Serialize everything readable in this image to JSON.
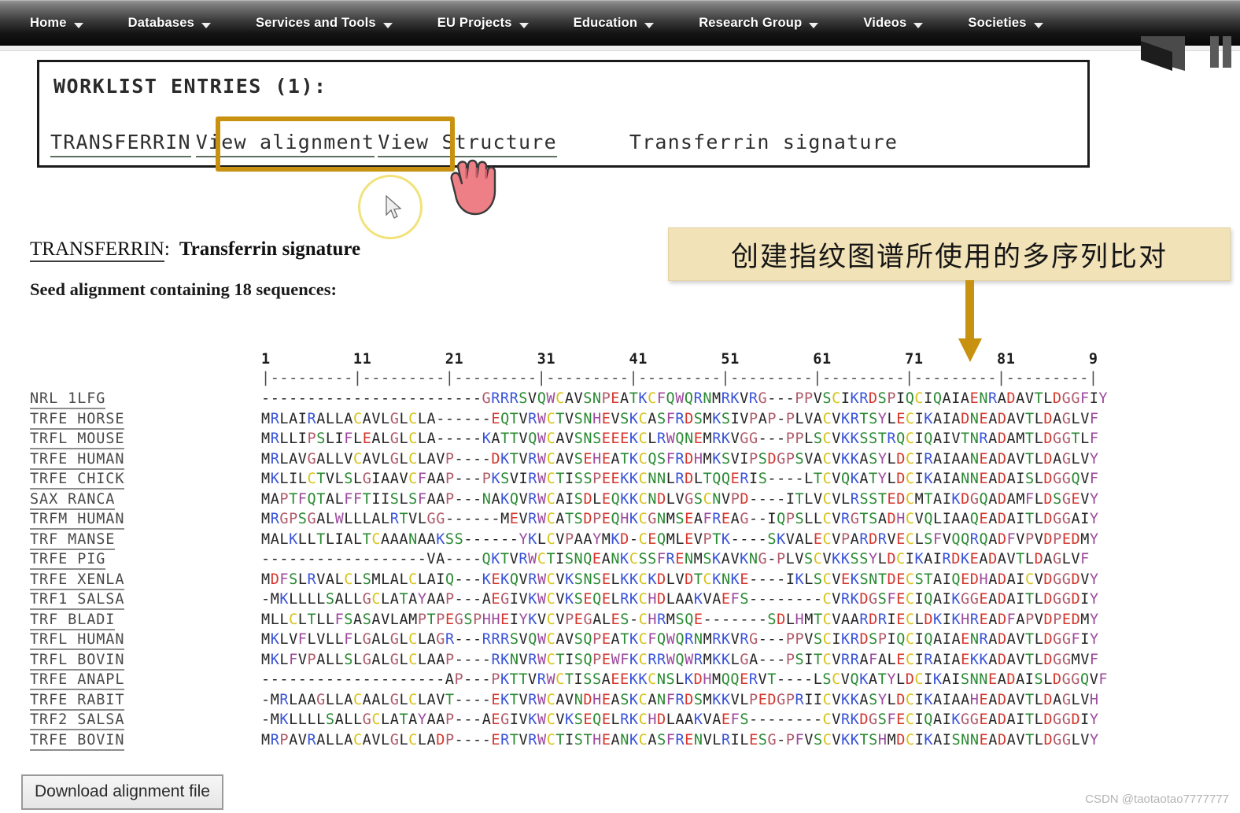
{
  "nav": {
    "items": [
      {
        "label": "Home",
        "has_caret": true
      },
      {
        "label": "Databases",
        "has_caret": true
      },
      {
        "label": "Services and Tools",
        "has_caret": true
      },
      {
        "label": "EU Projects",
        "has_caret": true
      },
      {
        "label": "Education",
        "has_caret": true
      },
      {
        "label": "Research Group",
        "has_caret": true
      },
      {
        "label": "Videos",
        "has_caret": true
      },
      {
        "label": "Societies",
        "has_caret": true
      }
    ]
  },
  "worklist": {
    "title": "WORKLIST ENTRIES (1):",
    "entry_code": "TRANSFERRIN",
    "view_alignment": "View alignment",
    "view_structure": "View Structure",
    "signature": "Transferrin signature"
  },
  "entry": {
    "code": "TRANSFERRIN",
    "separator": ":",
    "title": "Transferrin signature",
    "seed_line": "Seed alignment containing 18 sequences:"
  },
  "callout": {
    "text": "创建指纹图谱所使用的多序列比对",
    "background": "#f2e2b8",
    "arrow_color": "#c8910f"
  },
  "highlight": {
    "color": "#c8910f",
    "target": "View alignment"
  },
  "alignment": {
    "ruler_numbers": "1         11        21        31        41        51        61        71        81        9",
    "ruler_ticks": "|---------|---------|---------|---------|---------|---------|---------|---------|---------|",
    "rows": [
      {
        "name": "NRL 1LFG",
        "seq": "------------------------GRRRSVQWCAVSNPEATKCFQWQRNMRKVRG---PPVSCIKRDSPIQCIQAIAENRADAVTLDGGFIY"
      },
      {
        "name": "TRFE HORSE",
        "seq": "MRLAIRALLACAVLGLCLA------EQTVRWCTVSNHEVSKCASFRDSMKSIVPAP-PLVACVKRTSYLECIKAIADNEADAVTLDAGLVF"
      },
      {
        "name": "TRFL MOUSE",
        "seq": "MRLLIPSLIFLEALGLCLA-----KATTVQWCAVSNSEEEKCLRWQNEMRKVGG---PPLSCVKKSSTRQCIQAIVTNRADAMTLDGGTLF"
      },
      {
        "name": "TRFE HUMAN",
        "seq": "MRLAVGALLVCAVLGLCLAVP----DKTVRWCAVSEHEATKCQSFRDHMKSVIPSDGPSVACVKKASYLDCIRAIAANEADAVTLDAGLVY"
      },
      {
        "name": "TRFE CHICK",
        "seq": "MKLILCTVLSLGIAAVCFAAP---PKSVIRWCTISSPEEKKCNNLRDLTQQERIS----LTCVQKATYLDCIKAIANNEADAISLDGGQVF"
      },
      {
        "name": "SAX RANCA",
        "seq": "MAPTFQTALFFTIISLSFAAP---NAKQVRWCAISDLEQKKCNDLVGSCNVPD----ITLVCVLRSSTEDCMTAIKDGQADAMFLDSGEVY"
      },
      {
        "name": "TRFM HUMAN",
        "seq": "MRGPSGALWLLLALRTVLGG------MEVRWCATSDPEQHKCGNMSEAFREAG--IQPSLLCVRGTSADHCVQLIAAQEADAITLDGGAIY"
      },
      {
        "name": "TRF MANSE",
        "seq": "MALKLLTLIALTCAAANAAKSS------YKLCVPAAYMKD-CEQMLEVPTK----SKVALECVPARDRVECLSFVQQRQADFVPVDPEDMY"
      },
      {
        "name": "TRFE PIG",
        "seq": "------------------VA----QKTVRWCTISNQEANKCSSFRENMSKAVKNG-PLVSCVKKSSYLDCIKAIRDKEADAVTLDAGLVF"
      },
      {
        "name": "TRFE XENLA",
        "seq": "MDFSLRVALCLSMLALCLAIQ---KEKQVRWCVKSNSELKKCKDLVDTCKNKE----IKLSCVEKSNTDECSTAIQEDHADAICVDGGDVY"
      },
      {
        "name": "TRF1 SALSA",
        "seq": "-MKLLLLSALLGCLATAYAAP---AEGIVKWCVKSEQELRKCHDLAAKVAEFS--------CVRKDGSFECIQAIKGGEADAITLDGGDIY"
      },
      {
        "name": "TRF BLADI",
        "seq": "MLLCLTLLFSASAVLAMPTPEGSPHHEIYKVCVPEGALES-CHRMSQE-------SDLHMTCVAARDRIECLDKIKHREADFAPVDPEDMY"
      },
      {
        "name": "TRFL HUMAN",
        "seq": "MKLVFLVLLFLGALGLCLAGR---RRRSVQWCAVSQPEATKCFQWQRNMRKVRG---PPVSCIKRDSPIQCIQAIAENRADAVTLDGGFIY"
      },
      {
        "name": "TRFL BOVIN",
        "seq": "MKLFVPALLSLGALGLCLAAP----RKNVRWCTISQPEWFKCRRWQWRMKKLGA---PSITCVRRAFALECIRAIAEKKADAVTLDGGMVF"
      },
      {
        "name": "TRFE ANAPL",
        "seq": "--------------------AP---PKTTVRWCTISSAEEKKCNSLKDHMQQERVT----LSCVQKATYLDCIKAISNNEADAISLDGGQVF"
      },
      {
        "name": "TRFE RABIT",
        "seq": "-MRLAAGLLACAALGLCLAVT----EKTVRWCAVNDHEASKCANFRDSMKKVLPEDGPRIICVKKASYLDCIKAIAAHEADAVTLDAGLVH"
      },
      {
        "name": "TRF2 SALSA",
        "seq": "-MKLLLLSALLGCLATAYAAP---AEGIVKWCVKSEQELRKCHDLAAKVAEFS--------CVRKDGSFECIQAIKGGEADAITLDGGDIY"
      },
      {
        "name": "TRFE BOVIN",
        "seq": "MRPAVRALLACAVLGLCLADP----ERTVRWCTISTHEANKCASFRENVLRILESG-PFVSCVKKTSHMDCIKAISNNEADAVTLDGGLVY"
      }
    ]
  },
  "download": {
    "label": "Download alignment file"
  },
  "watermark": "CSDN @taotaotao7777777"
}
